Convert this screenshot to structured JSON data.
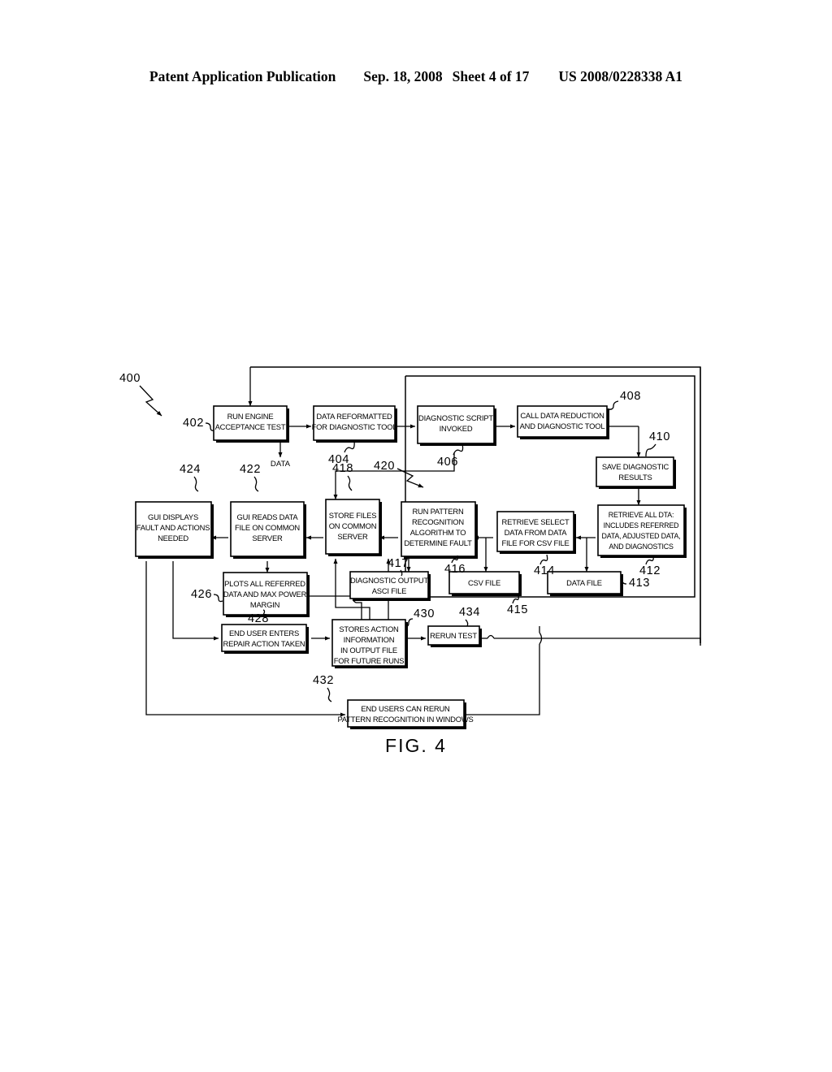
{
  "header": {
    "publication": "Patent Application Publication",
    "date": "Sep. 18, 2008",
    "sheet": "Sheet 4 of 17",
    "docnum": "US 2008/0228338 A1"
  },
  "figure": {
    "caption": "FIG. 4",
    "data_flow_label": "DATA"
  },
  "chart_data": {
    "type": "diagram",
    "title": "FIG. 4",
    "diagram_kind": "flowchart",
    "overall_ref": "400",
    "nodes": [
      {
        "ref": "402",
        "lines": [
          "RUN ENGINE",
          "ACCEPTANCE TEST"
        ]
      },
      {
        "ref": "404",
        "lines": [
          "DATA REFORMATTED",
          "FOR DIAGNOSTIC TOOL"
        ]
      },
      {
        "ref": "406",
        "lines": [
          "DIAGNOSTIC SCRIPT",
          "INVOKED"
        ]
      },
      {
        "ref": "408",
        "lines": [
          "CALL DATA REDUCTION",
          "AND DIAGNOSTIC TOOL"
        ]
      },
      {
        "ref": "410",
        "lines": [
          "SAVE DIAGNOSTIC",
          "RESULTS"
        ]
      },
      {
        "ref": "412",
        "lines": [
          "RETRIEVE ALL DTA:",
          "INCLUDES REFERRED",
          "DATA, ADJUSTED DATA,",
          "AND DIAGNOSTICS"
        ]
      },
      {
        "ref": "413",
        "lines": [
          "DATA FILE"
        ]
      },
      {
        "ref": "414",
        "lines": [
          "RETRIEVE SELECT",
          "DATA FROM DATA",
          "FILE FOR CSV FILE"
        ]
      },
      {
        "ref": "415",
        "lines": [
          "CSV FILE"
        ]
      },
      {
        "ref": "416",
        "lines": [
          "RUN PATTERN",
          "RECOGNITION",
          "ALGORITHM TO",
          "DETERMINE FAULT"
        ]
      },
      {
        "ref": "417",
        "lines": [
          "DIAGNOSTIC OUTPUT",
          "ASCI FILE"
        ]
      },
      {
        "ref": "418",
        "lines": [
          "STORE FILES",
          "ON COMMON",
          "SERVER"
        ]
      },
      {
        "ref": "422",
        "lines": [
          "GUI READS DATA",
          "FILE ON COMMON",
          "SERVER"
        ]
      },
      {
        "ref": "424",
        "lines": [
          "GUI DISPLAYS",
          "FAULT AND ACTIONS",
          "NEEDED"
        ]
      },
      {
        "ref": "426",
        "lines": [
          "PLOTS ALL REFERRED",
          "DATA AND MAX POWER",
          "MARGIN"
        ]
      },
      {
        "ref": "428",
        "lines": [
          "END USER ENTERS",
          "REPAIR ACTION TAKEN"
        ]
      },
      {
        "ref": "430",
        "lines": [
          "STORES ACTION",
          "INFORMATION",
          "IN OUTPUT FILE",
          "FOR FUTURE RUNS"
        ]
      },
      {
        "ref": "432",
        "lines": [
          "END USERS CAN RERUN",
          "PATTERN RECOGNITION IN WINDOWS"
        ]
      },
      {
        "ref": "434",
        "lines": [
          "RERUN TEST"
        ]
      }
    ],
    "group_ref": "420",
    "edge_label": "DATA"
  },
  "refs": {
    "r400": "400",
    "r402": "402",
    "r404": "404",
    "r406": "406",
    "r408": "408",
    "r410": "410",
    "r412": "412",
    "r413": "413",
    "r414": "414",
    "r415": "415",
    "r416": "416",
    "r417": "417",
    "r418": "418",
    "r420": "420",
    "r422": "422",
    "r424": "424",
    "r426": "426",
    "r428": "428",
    "r430": "430",
    "r432": "432",
    "r434": "434"
  },
  "boxes": {
    "b402": {
      "l1": "RUN ENGINE",
      "l2": "ACCEPTANCE TEST"
    },
    "b404": {
      "l1": "DATA REFORMATTED",
      "l2": "FOR DIAGNOSTIC TOOL"
    },
    "b406": {
      "l1": "DIAGNOSTIC SCRIPT",
      "l2": "INVOKED"
    },
    "b408": {
      "l1": "CALL DATA REDUCTION",
      "l2": "AND DIAGNOSTIC TOOL"
    },
    "b410": {
      "l1": "SAVE DIAGNOSTIC",
      "l2": "RESULTS"
    },
    "b412": {
      "l1": "RETRIEVE ALL DTA:",
      "l2": "INCLUDES REFERRED",
      "l3": "DATA, ADJUSTED DATA,",
      "l4": "AND DIAGNOSTICS"
    },
    "b413": {
      "l1": "DATA FILE"
    },
    "b414": {
      "l1": "RETRIEVE SELECT",
      "l2": "DATA FROM DATA",
      "l3": "FILE FOR CSV FILE"
    },
    "b415": {
      "l1": "CSV FILE"
    },
    "b416": {
      "l1": "RUN PATTERN",
      "l2": "RECOGNITION",
      "l3": "ALGORITHM TO",
      "l4": "DETERMINE FAULT"
    },
    "b417": {
      "l1": "DIAGNOSTIC OUTPUT",
      "l2": "ASCI FILE"
    },
    "b418": {
      "l1": "STORE FILES",
      "l2": "ON COMMON",
      "l3": "SERVER"
    },
    "b422": {
      "l1": "GUI READS DATA",
      "l2": "FILE ON COMMON",
      "l3": "SERVER"
    },
    "b424": {
      "l1": "GUI DISPLAYS",
      "l2": "FAULT AND ACTIONS",
      "l3": "NEEDED"
    },
    "b426": {
      "l1": "PLOTS ALL REFERRED",
      "l2": "DATA AND MAX POWER",
      "l3": "MARGIN"
    },
    "b428": {
      "l1": "END USER ENTERS",
      "l2": "REPAIR ACTION TAKEN"
    },
    "b430": {
      "l1": "STORES ACTION",
      "l2": "INFORMATION",
      "l3": "IN OUTPUT FILE",
      "l4": "FOR FUTURE RUNS"
    },
    "b432": {
      "l1": "END USERS CAN RERUN",
      "l2": "PATTERN RECOGNITION IN WINDOWS"
    },
    "b434": {
      "l1": "RERUN TEST"
    }
  }
}
